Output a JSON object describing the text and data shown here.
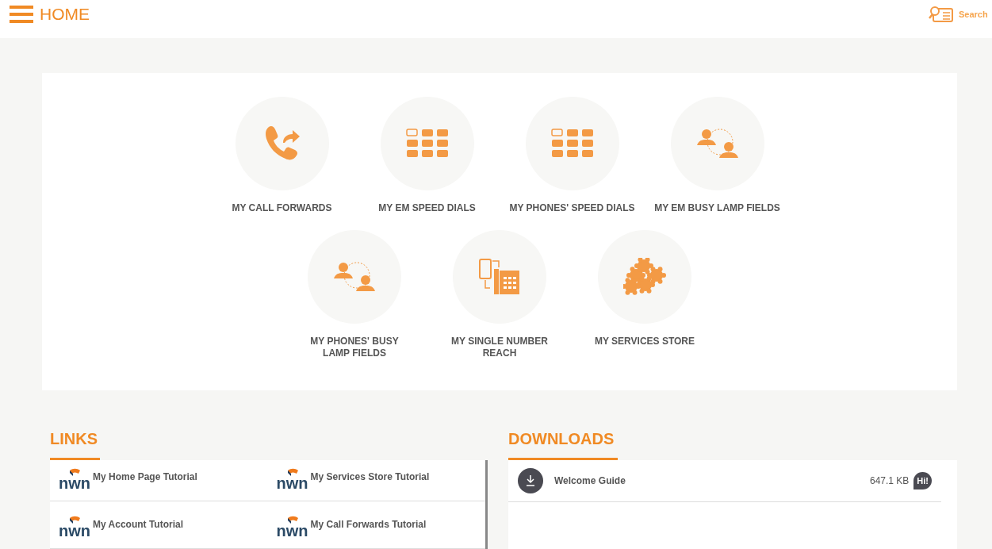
{
  "header": {
    "title": "HOME",
    "search_label": "Search"
  },
  "tiles": [
    {
      "label": "MY CALL FORWARDS",
      "kind": "forward"
    },
    {
      "label": "MY EM SPEED DIALS",
      "kind": "dials"
    },
    {
      "label": "MY PHONES' SPEED DIALS",
      "kind": "dials"
    },
    {
      "label": "MY EM BUSY LAMP FIELDS",
      "kind": "blf"
    },
    {
      "label": "MY PHONES' BUSY LAMP FIELDS",
      "kind": "blf"
    },
    {
      "label": "MY SINGLE NUMBER REACH",
      "kind": "reach"
    },
    {
      "label": "MY SERVICES STORE",
      "kind": "store"
    }
  ],
  "links": {
    "title": "LINKS",
    "items": [
      {
        "logo": "nwn",
        "label": "My Home Page Tutorial"
      },
      {
        "logo": "nwn",
        "label": "My Services Store Tutorial"
      },
      {
        "logo": "nwn",
        "label": "My Account Tutorial"
      },
      {
        "logo": "nwn",
        "label": "My Call Forwards Tutorial"
      }
    ]
  },
  "downloads": {
    "title": "DOWNLOADS",
    "items": [
      {
        "name": "Welcome Guide",
        "size": "647.1 KB",
        "badge": "Hi!"
      }
    ]
  }
}
